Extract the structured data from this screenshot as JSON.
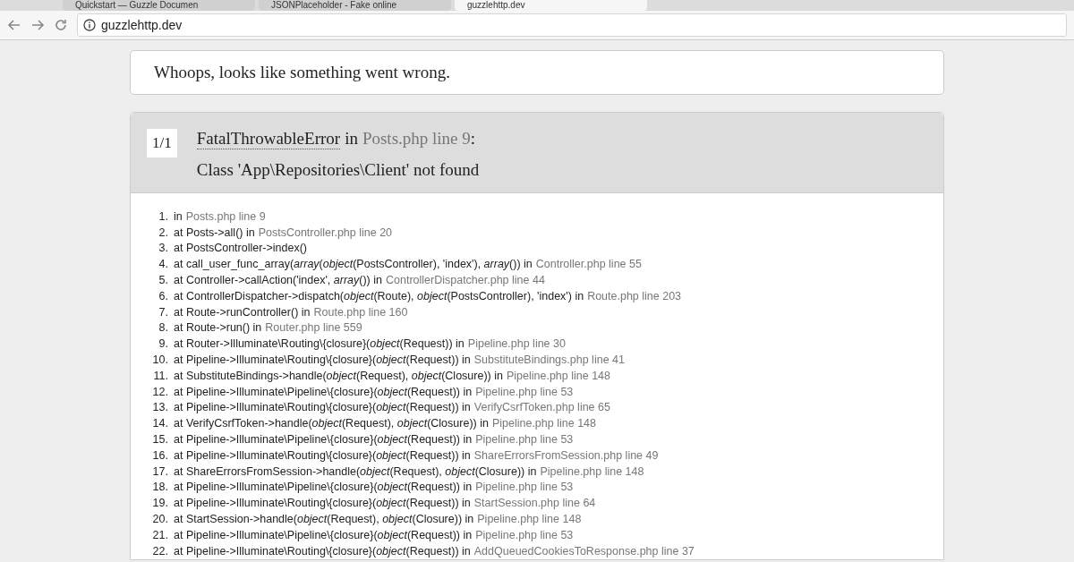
{
  "tabs": [
    {
      "label": "Quickstart — Guzzle Documen",
      "selected": false
    },
    {
      "label": "JSONPlaceholder - Fake online",
      "selected": false
    },
    {
      "label": "guzzlehttp.dev",
      "selected": true
    }
  ],
  "address_bar": {
    "url": "guzzlehttp.dev"
  },
  "notice": "Whoops, looks like something went wrong.",
  "exception": {
    "count": "1/1",
    "class": "FatalThrowableError",
    "in": "in",
    "location": "Posts.php line 9",
    "colon": ":",
    "message": "Class 'App\\Repositories\\Client' not found"
  },
  "trace": [
    {
      "num": "1.",
      "call": "in",
      "location": "Posts.php line 9"
    },
    {
      "num": "2.",
      "call": "at Posts->all() in",
      "location": "PostsController.php line 20"
    },
    {
      "num": "3.",
      "call": "at PostsController->index()"
    },
    {
      "num": "4.",
      "call": "at call_user_func_array(*array*(*object*(PostsController), 'index'), *array*()) in",
      "location": "Controller.php line 55"
    },
    {
      "num": "5.",
      "call": "at Controller->callAction('index', *array*()) in",
      "location": "ControllerDispatcher.php line 44"
    },
    {
      "num": "6.",
      "call": "at ControllerDispatcher->dispatch(*object*(Route), *object*(PostsController), 'index') in",
      "location": "Route.php line 203"
    },
    {
      "num": "7.",
      "call": "at Route->runController() in",
      "location": "Route.php line 160"
    },
    {
      "num": "8.",
      "call": "at Route->run() in",
      "location": "Router.php line 559"
    },
    {
      "num": "9.",
      "call": "at Router->Illuminate\\Routing\\{closure}(*object*(Request)) in",
      "location": "Pipeline.php line 30"
    },
    {
      "num": "10.",
      "call": "at Pipeline->Illuminate\\Routing\\{closure}(*object*(Request)) in",
      "location": "SubstituteBindings.php line 41"
    },
    {
      "num": "11.",
      "call": "at SubstituteBindings->handle(*object*(Request), *object*(Closure)) in",
      "location": "Pipeline.php line 148"
    },
    {
      "num": "12.",
      "call": "at Pipeline->Illuminate\\Pipeline\\{closure}(*object*(Request)) in",
      "location": "Pipeline.php line 53"
    },
    {
      "num": "13.",
      "call": "at Pipeline->Illuminate\\Routing\\{closure}(*object*(Request)) in",
      "location": "VerifyCsrfToken.php line 65"
    },
    {
      "num": "14.",
      "call": "at VerifyCsrfToken->handle(*object*(Request), *object*(Closure)) in",
      "location": "Pipeline.php line 148"
    },
    {
      "num": "15.",
      "call": "at Pipeline->Illuminate\\Pipeline\\{closure}(*object*(Request)) in",
      "location": "Pipeline.php line 53"
    },
    {
      "num": "16.",
      "call": "at Pipeline->Illuminate\\Routing\\{closure}(*object*(Request)) in",
      "location": "ShareErrorsFromSession.php line 49"
    },
    {
      "num": "17.",
      "call": "at ShareErrorsFromSession->handle(*object*(Request), *object*(Closure)) in",
      "location": "Pipeline.php line 148"
    },
    {
      "num": "18.",
      "call": "at Pipeline->Illuminate\\Pipeline\\{closure}(*object*(Request)) in",
      "location": "Pipeline.php line 53"
    },
    {
      "num": "19.",
      "call": "at Pipeline->Illuminate\\Routing\\{closure}(*object*(Request)) in",
      "location": "StartSession.php line 64"
    },
    {
      "num": "20.",
      "call": "at StartSession->handle(*object*(Request), *object*(Closure)) in",
      "location": "Pipeline.php line 148"
    },
    {
      "num": "21.",
      "call": "at Pipeline->Illuminate\\Pipeline\\{closure}(*object*(Request)) in",
      "location": "Pipeline.php line 53"
    },
    {
      "num": "22.",
      "call": "at Pipeline->Illuminate\\Routing\\{closure}(*object*(Request)) in",
      "location": "AddQueuedCookiesToResponse.php line 37"
    }
  ]
}
